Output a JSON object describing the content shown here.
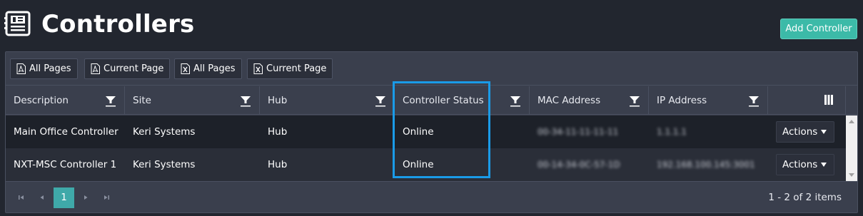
{
  "header": {
    "title": "Controllers",
    "add_button_label": "Add Controller"
  },
  "toolbar": {
    "buttons": [
      {
        "label": "All Pages",
        "icon": "pdf-icon"
      },
      {
        "label": "Current Page",
        "icon": "pdf-icon"
      },
      {
        "label": "All Pages",
        "icon": "excel-icon"
      },
      {
        "label": "Current Page",
        "icon": "excel-icon"
      }
    ]
  },
  "table": {
    "columns": [
      "Description",
      "Site",
      "Hub",
      "Controller Status",
      "MAC Address",
      "IP Address"
    ],
    "rows": [
      {
        "description": "Main Office Controller",
        "site": "Keri Systems",
        "hub": "Hub",
        "status": "Online",
        "mac": "00-34-11-11-11-11",
        "ip": "1.1.1.1",
        "action_label": "Actions"
      },
      {
        "description": "NXT-MSC Controller 1",
        "site": "Keri Systems",
        "hub": "Hub",
        "status": "Online",
        "mac": "00-14-34-0C-57-1D",
        "ip": "192.168.100.145:3001",
        "action_label": "Actions"
      }
    ]
  },
  "pager": {
    "current_page": "1",
    "info": "1 - 2 of 2 items"
  },
  "colors": {
    "accent": "#3cbaa8",
    "page_active": "#3fa9a9",
    "highlight": "#1a9be8"
  }
}
